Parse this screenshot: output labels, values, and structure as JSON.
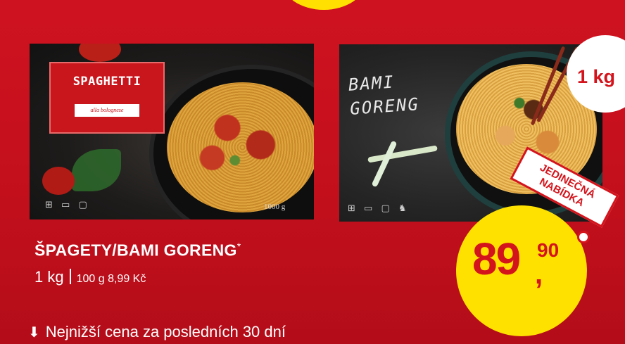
{
  "pack1": {
    "label_title": "SPAGHETTI",
    "label_sub": "alla bolognese",
    "weight": "1000 g",
    "icons": "⊞ ▭ ▢"
  },
  "pack2": {
    "title_line1": "BAMI",
    "title_line2": "GORENG",
    "icons": "⊞ ▭ ▢ ♞"
  },
  "badge": {
    "weight": "1 kg"
  },
  "ribbon": {
    "line1": "JEDINEČNÁ",
    "line2": "NABÍDKA"
  },
  "price": {
    "main": "89",
    "cents": "90",
    "comma": ","
  },
  "product": {
    "name": "ŠPAGETY/BAMI GORENG",
    "asterisk": "*",
    "qty": "1 kg",
    "unit_price": "100 g 8,99 Kč"
  },
  "lowest_price_text": "Nejnižší cena za posledních 30 dní",
  "colors": {
    "background": "#c8101e",
    "price_circle": "#ffe100",
    "accent": "#d4141c"
  },
  "icon_names": {
    "lowest_price": "arrow-down-icon"
  }
}
